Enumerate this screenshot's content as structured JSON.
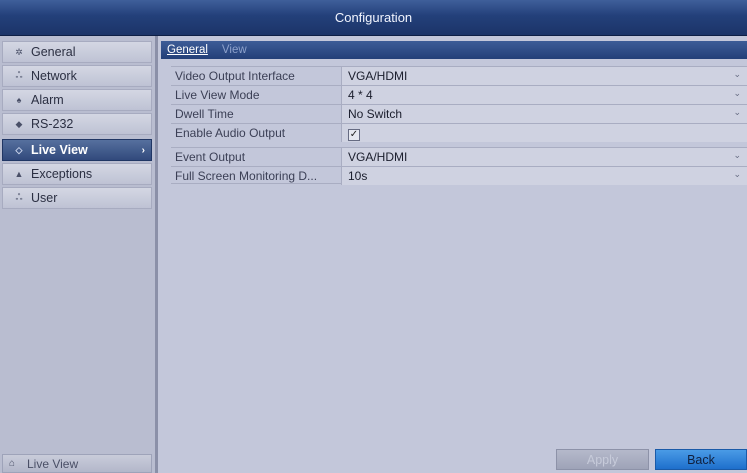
{
  "window": {
    "title": "Configuration"
  },
  "sidebar": {
    "items": [
      {
        "label": "General",
        "icon": "gear-icon"
      },
      {
        "label": "Network",
        "icon": "network-icon"
      },
      {
        "label": "Alarm",
        "icon": "alarm-icon"
      },
      {
        "label": "RS-232",
        "icon": "serial-port-icon"
      },
      {
        "label": "Live View",
        "icon": "live-view-icon",
        "active": true
      },
      {
        "label": "Exceptions",
        "icon": "warning-icon"
      },
      {
        "label": "User",
        "icon": "users-icon"
      }
    ],
    "bottom": {
      "label": "Live View",
      "icon": "home-icon"
    }
  },
  "tabs": [
    {
      "label": "General",
      "active": true
    },
    {
      "label": "View",
      "active": false
    }
  ],
  "settings": [
    {
      "label": "Video Output Interface",
      "value": "VGA/HDMI",
      "type": "dropdown"
    },
    {
      "label": "Live View Mode",
      "value": "4 * 4",
      "type": "dropdown"
    },
    {
      "label": "Dwell Time",
      "value": "No Switch",
      "type": "dropdown"
    },
    {
      "label": "Enable Audio Output",
      "value": "✓",
      "type": "checkbox"
    },
    {
      "label": "Event Output",
      "value": "VGA/HDMI",
      "type": "dropdown"
    },
    {
      "label": "Full Screen Monitoring D...",
      "value": "10s",
      "type": "dropdown"
    }
  ],
  "buttons": {
    "apply": "Apply",
    "back": "Back"
  },
  "colors": {
    "accent": "#23407a",
    "active_button": "#1e6fcc",
    "background": "#c3c7da"
  }
}
